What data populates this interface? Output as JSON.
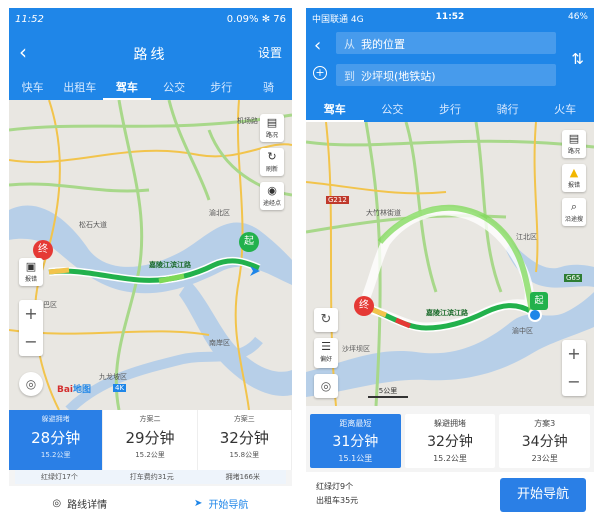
{
  "left": {
    "status": {
      "time": "11:52",
      "right": "0.09% ✻ 76"
    },
    "title": "路线",
    "settings": "设置",
    "tabs": [
      "快车",
      "出租车",
      "驾车",
      "公交",
      "步行",
      "骑"
    ],
    "map": {
      "labels": [
        "机场路",
        "松石大道",
        "渝北区",
        "南岸区",
        "九龙坡区",
        "巴区",
        "沙坪坝区",
        "4K"
      ],
      "road_name": "嘉陵江滨江路",
      "start_marker": "起",
      "end_marker": "终",
      "buttons": {
        "traffic": "路况",
        "refresh": "刷新",
        "waypoint": "途经点",
        "report": "报错"
      },
      "logo": "百度地图"
    },
    "cards": [
      {
        "tag": "躲避拥堵",
        "duration": "28分钟",
        "distance": "15.2公里"
      },
      {
        "tag": "方案二",
        "duration": "29分钟",
        "distance": "15.2公里"
      },
      {
        "tag": "方案三",
        "duration": "32分钟",
        "distance": "15.8公里"
      }
    ],
    "info": [
      "红绿灯17个",
      "打车费约31元",
      "拥堵166米"
    ],
    "bottom": {
      "detail": "路线详情",
      "navigate": "开始导航"
    }
  },
  "right": {
    "status": {
      "carrier": "中国联通 4G",
      "time": "11:52",
      "right": "46%"
    },
    "from_prefix": "从",
    "from": "我的位置",
    "to_prefix": "到",
    "to": "沙坪坝(地铁站)",
    "tabs": [
      "驾车",
      "公交",
      "步行",
      "骑行",
      "火车"
    ],
    "map": {
      "labels": [
        "G212",
        "大竹林街道",
        "江北区",
        "沙坪坝区",
        "渝中区",
        "G65"
      ],
      "road_name": "嘉陵江滨江路",
      "start_marker": "起",
      "end_marker": "终",
      "scale": "5公里",
      "buttons": {
        "traffic": "路况",
        "report": "报错",
        "search": "沿途搜",
        "prefs": "偏好"
      }
    },
    "cards": [
      {
        "tag": "距离最短",
        "duration": "31分钟",
        "distance": "15.1公里"
      },
      {
        "tag": "躲避拥堵",
        "duration": "32分钟",
        "distance": "15.2公里"
      },
      {
        "tag": "方案3",
        "duration": "34分钟",
        "distance": "23公里"
      }
    ],
    "info": {
      "lights": "红绿灯9个",
      "taxi": "出租车35元"
    },
    "navigate": "开始导航"
  },
  "colors": {
    "primary": "#1f86e8",
    "route": "#22b14c",
    "traffic_jam": "#e53935",
    "water": "#b7cfe8",
    "map_bg": "#e9e7e2"
  }
}
